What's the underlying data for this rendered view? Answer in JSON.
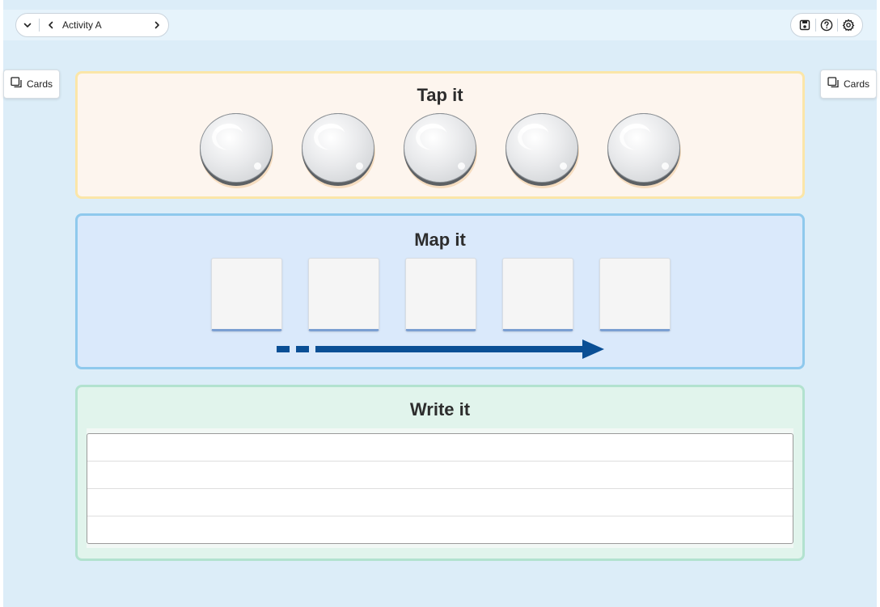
{
  "header": {
    "activity_title": "Activity A",
    "icons": {
      "menu": "chevron-down-icon",
      "prev": "chevron-left-icon",
      "next": "chevron-right-icon",
      "save": "save-icon",
      "help": "help-icon",
      "settings": "gear-icon"
    }
  },
  "sidebar_buttons": {
    "left_label": "Cards",
    "right_label": "Cards",
    "icon": "cards-icon"
  },
  "sections": {
    "tap": {
      "title": "Tap it",
      "counter_count": 5
    },
    "map": {
      "title": "Map it",
      "frame_count": 5
    },
    "write": {
      "title": "Write it",
      "line_count": 4
    }
  },
  "colors": {
    "background": "#dcedf8",
    "tap_border": "#fbe6a8",
    "map_border": "#8fc9ed",
    "write_border": "#b2e2cf",
    "arrow": "#0a4f95"
  }
}
